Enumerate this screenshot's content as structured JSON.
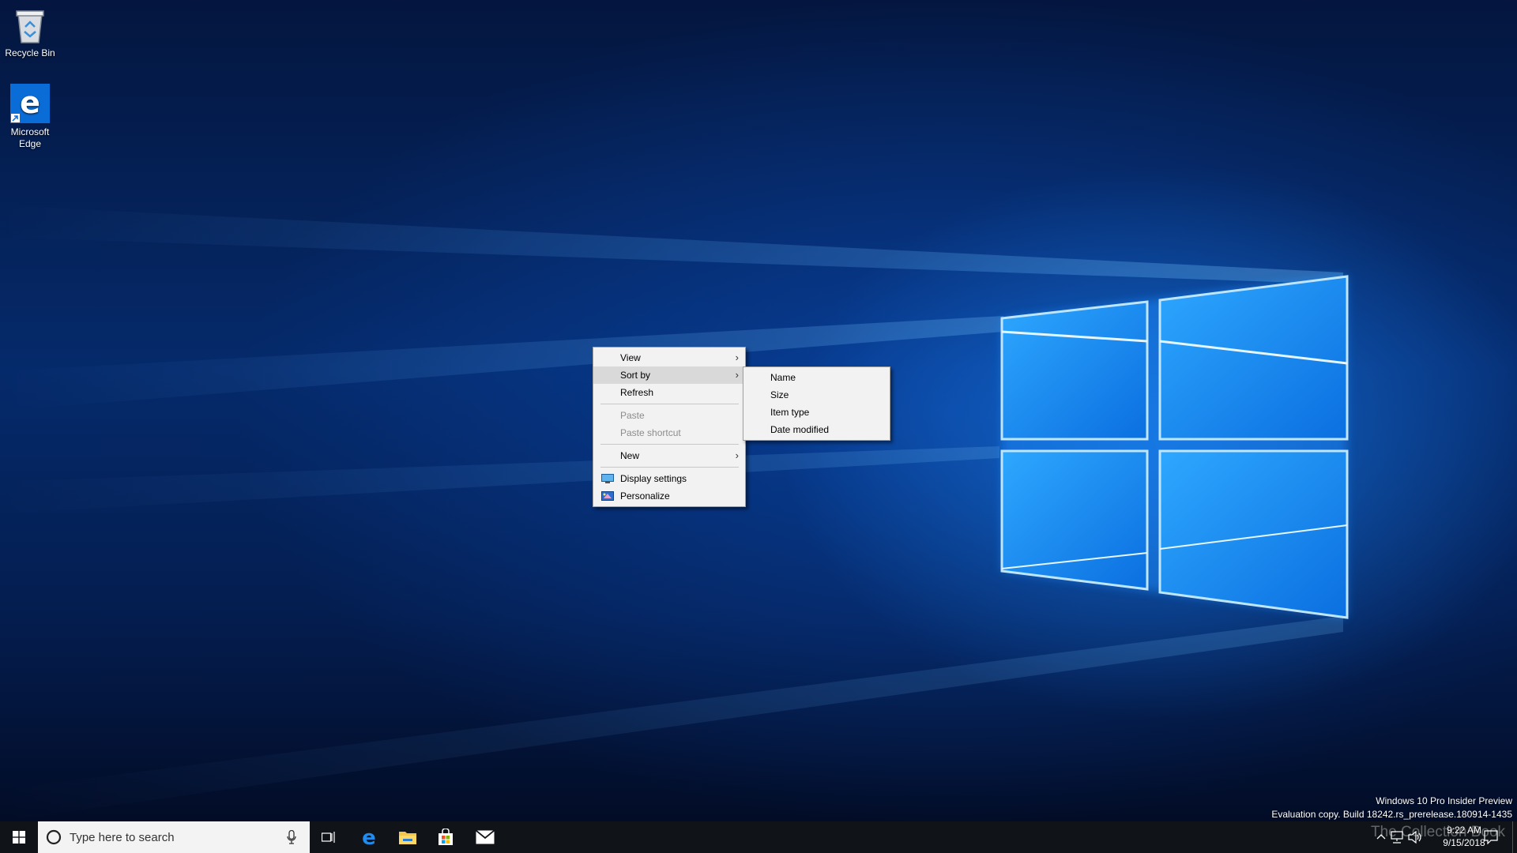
{
  "desktop": {
    "icons": [
      {
        "label": "Recycle Bin",
        "icon": "recycle-bin-icon"
      },
      {
        "label": "Microsoft Edge",
        "icon": "edge-icon"
      }
    ]
  },
  "context_menu": {
    "items": [
      {
        "label": "View",
        "has_submenu": true,
        "enabled": true
      },
      {
        "label": "Sort by",
        "has_submenu": true,
        "enabled": true,
        "highlighted": true
      },
      {
        "label": "Refresh",
        "enabled": true
      },
      {
        "label": "Paste",
        "enabled": false
      },
      {
        "label": "Paste shortcut",
        "enabled": false
      },
      {
        "label": "New",
        "has_submenu": true,
        "enabled": true
      },
      {
        "label": "Display settings",
        "icon": "display-settings-icon",
        "enabled": true
      },
      {
        "label": "Personalize",
        "icon": "personalize-icon",
        "enabled": true
      }
    ],
    "submenu_sort_by": [
      "Name",
      "Size",
      "Item type",
      "Date modified"
    ]
  },
  "taskbar": {
    "search_placeholder": "Type here to search",
    "pinned": [
      "task-view-icon",
      "edge-icon",
      "file-explorer-icon",
      "store-icon",
      "mail-icon"
    ],
    "clock_time": "9:22 AM",
    "clock_date": "9/15/2018"
  },
  "watermark": {
    "line1": "Windows 10 Pro Insider Preview",
    "line2": "Evaluation copy. Build 18242.rs_prerelease.180914-1435",
    "brand": "The Collection Book"
  },
  "colors": {
    "accent": "#0a6cd6",
    "taskbar": "#101418",
    "menu_bg": "#f2f2f2",
    "menu_highlight": "#d9d9d9"
  }
}
